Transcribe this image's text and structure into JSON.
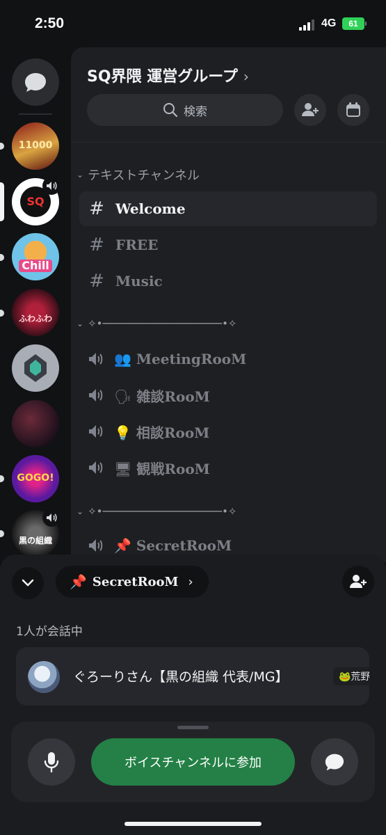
{
  "status_bar": {
    "time": "2:50",
    "network": "4G",
    "battery": "61"
  },
  "servers": [
    {
      "name": "announcement-banner-server",
      "label": "11000",
      "colors": [
        "#8a1a1a",
        "#d9a441"
      ]
    },
    {
      "name": "sq-server",
      "label": "SQ",
      "colors": [
        "#ffffff",
        "#111111"
      ]
    },
    {
      "name": "chill-server",
      "label": "Chill",
      "colors": [
        "#6fc3e8",
        "#f3b04a"
      ]
    },
    {
      "name": "fuwafuwa-server",
      "label": "ふわふわ",
      "colors": [
        "#3a0f1a",
        "#b0203a"
      ]
    },
    {
      "name": "emblem-server",
      "label": "",
      "colors": [
        "#a9adb5",
        "#3a3d44"
      ]
    },
    {
      "name": "dark-art-server",
      "label": "",
      "colors": [
        "#3a1a2a",
        "#6b2a3a"
      ]
    },
    {
      "name": "gogo-server",
      "label": "GOGO!",
      "colors": [
        "#5a1aa0",
        "#e0228a"
      ]
    },
    {
      "name": "kuro-soshiki-server",
      "label": "黒の組織",
      "colors": [
        "#1a1a1a",
        "#6a6a6a"
      ]
    }
  ],
  "header": {
    "server_name": "SQ界隈 運営グループ",
    "chevron": "›",
    "search_placeholder": "検索"
  },
  "categories": {
    "text": "テキストチャンネル",
    "divider1": "✧•───────────────────•✧",
    "divider2": "✧•───────────────────•✧"
  },
  "text_channels": [
    {
      "name": "Welcome"
    },
    {
      "name": "FREE"
    },
    {
      "name": "Music"
    }
  ],
  "voice_channels": [
    {
      "emoji": "👥",
      "name": "MeetingRooM"
    },
    {
      "emoji": "🗣",
      "name": "雑談RooM"
    },
    {
      "emoji": "💡",
      "name": "相談RooM"
    },
    {
      "emoji": "🖥",
      "name": "観戦RooM"
    },
    {
      "emoji": "📌",
      "name": "SecretRooM"
    }
  ],
  "sheet": {
    "room_emoji": "📌",
    "room_name": "SecretRooM",
    "room_chevron": "›",
    "talking_count": "1人が会話中",
    "member": {
      "name": "ぐろーりさん【黒の組織 代表/MG】",
      "tag": "🐸荒野"
    },
    "join_label": "ボイスチャンネルに参加"
  },
  "icons": {
    "chat": "chat-bubble-icon",
    "search": "search-icon",
    "add_member": "add-member-icon",
    "calendar": "calendar-icon",
    "speaker": "speaker-icon",
    "mic": "microphone-icon",
    "collapse": "chevron-down-icon"
  },
  "colors": {
    "accent_green": "#248046",
    "background": "#111214",
    "panel": "#1e1f22"
  }
}
